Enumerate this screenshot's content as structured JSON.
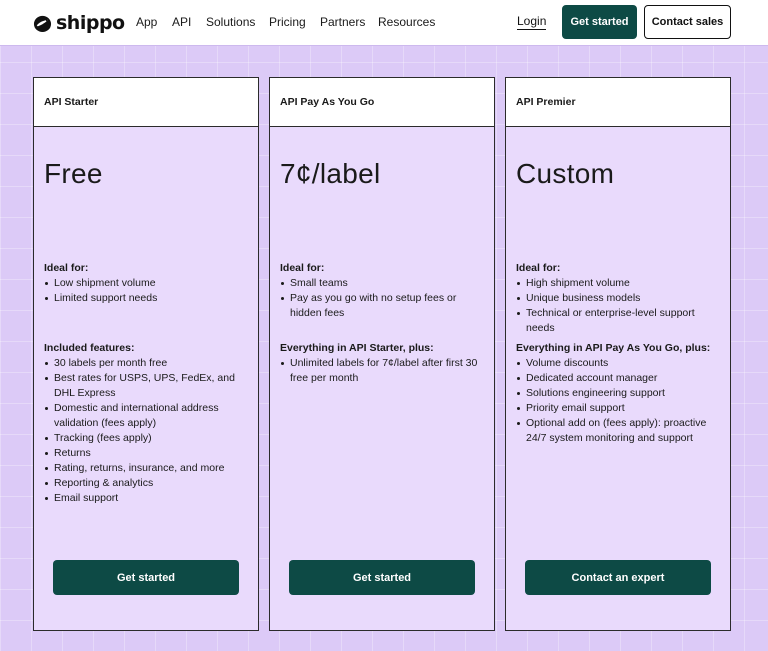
{
  "header": {
    "logo_text": "shippo",
    "nav": [
      "App",
      "API",
      "Solutions",
      "Pricing",
      "Partners",
      "Resources"
    ],
    "login_label": "Login",
    "get_started_label": "Get started",
    "contact_sales_label": "Contact sales"
  },
  "colors": {
    "accent": "#0d4a45",
    "background": "#dccaf7",
    "card_background": "#e9dafc"
  },
  "plans": [
    {
      "name": "API Starter",
      "price": "Free",
      "ideal_title": "Ideal for:",
      "ideal_items": [
        "Low shipment volume",
        "Limited support needs"
      ],
      "features_title": "Included features:",
      "features": [
        "30 labels per month free",
        "Best rates for USPS, UPS, FedEx, and DHL Express",
        "Domestic and international address validation (fees apply)",
        "Tracking (fees apply)",
        "Returns",
        "Rating, returns, insurance, and more",
        "Reporting & analytics",
        "Email support"
      ],
      "cta": "Get started"
    },
    {
      "name": "API Pay As You Go",
      "price": "7¢/label",
      "ideal_title": "Ideal for:",
      "ideal_items": [
        "Small teams",
        "Pay as you go with no setup fees or hidden fees"
      ],
      "features_title": "Everything in API Starter, plus:",
      "features": [
        "Unlimited labels for 7¢/label after first 30 free per month"
      ],
      "cta": "Get started"
    },
    {
      "name": "API Premier",
      "price": "Custom",
      "ideal_title": "Ideal for:",
      "ideal_items": [
        "High shipment volume",
        "Unique business models",
        "Technical or enterprise-level support needs"
      ],
      "features_title": "Everything in API Pay As You Go, plus:",
      "features": [
        "Volume discounts",
        "Dedicated account manager",
        "Solutions engineering support",
        "Priority email support",
        "Optional add on (fees apply): proactive 24/7 system monitoring and support"
      ],
      "cta": "Contact an expert"
    }
  ]
}
